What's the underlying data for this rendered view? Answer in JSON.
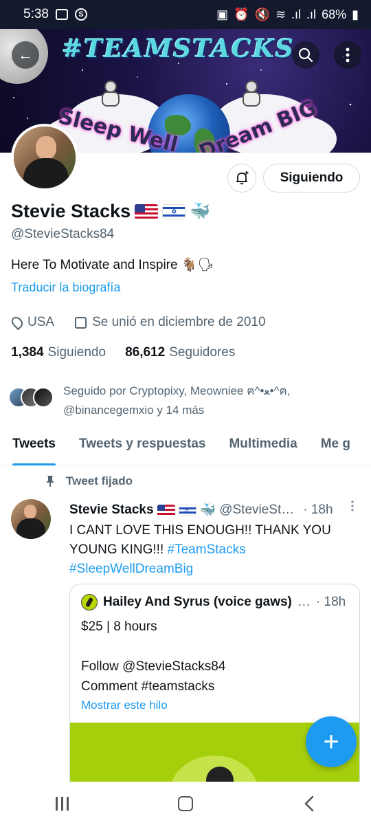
{
  "status_bar": {
    "time": "5:38",
    "battery": "68%",
    "icons": [
      "gallery-icon",
      "s-icon",
      "lock-icon",
      "alarm-icon",
      "mute-icon",
      "wifi-icon",
      "signal-icon",
      "battery-icon"
    ]
  },
  "header": {
    "back_icon": "back-arrow-icon",
    "search_icon": "search-icon",
    "more_icon": "more-vertical-icon"
  },
  "banner": {
    "title": "#TEAMSTACKS",
    "slogan_left": "Sleep Well",
    "slogan_right": "Dream BIG"
  },
  "profile": {
    "name": "Stevie Stacks",
    "handle": "@StevieStacks84",
    "bio": "Here To Motivate and Inspire 🐐🗣",
    "translate_label": "Traducir la biografía",
    "location": "USA",
    "joined": "Se unió en diciembre de 2010",
    "following_count": "1,384",
    "following_label": "Siguiendo",
    "followers_count": "86,612",
    "followers_label": "Seguidores",
    "followed_by": "Seguido por Cryptopixy, Meowniee ฅ^•ﻌ•^ฅ, @binancegemxio y 14 más",
    "follow_button": "Siguiendo",
    "whale": "🐳"
  },
  "tabs": [
    {
      "label": "Tweets",
      "active": true
    },
    {
      "label": "Tweets y respuestas",
      "active": false
    },
    {
      "label": "Multimedia",
      "active": false
    },
    {
      "label": "Me g",
      "active": false
    }
  ],
  "pinned_label": "Tweet fijado",
  "tweet": {
    "name": "Stevie Stacks",
    "handle": "@StevieSt…",
    "time": "· 18h",
    "text_1": "I CANT LOVE THIS ENOUGH!! THANK YOU YOUNG KING!!! ",
    "hashtag_1": "#TeamStacks",
    "hashtag_2": "#SleepWellDreamBig",
    "more": "⋮"
  },
  "quote": {
    "name": "Hailey And Syrus (voice gaws)",
    "ellipsis": "…",
    "time": "· 18h",
    "line_1": "$25 | 8 hours",
    "line_2": "Follow @StevieStacks84",
    "line_3": "Comment #teamstacks",
    "show_thread": "Mostrar este hilo"
  },
  "fab_label": "+",
  "colors": {
    "accent": "#1d9bf0",
    "text_primary": "#0f1419",
    "text_secondary": "#536471",
    "border": "#cfd9de"
  }
}
